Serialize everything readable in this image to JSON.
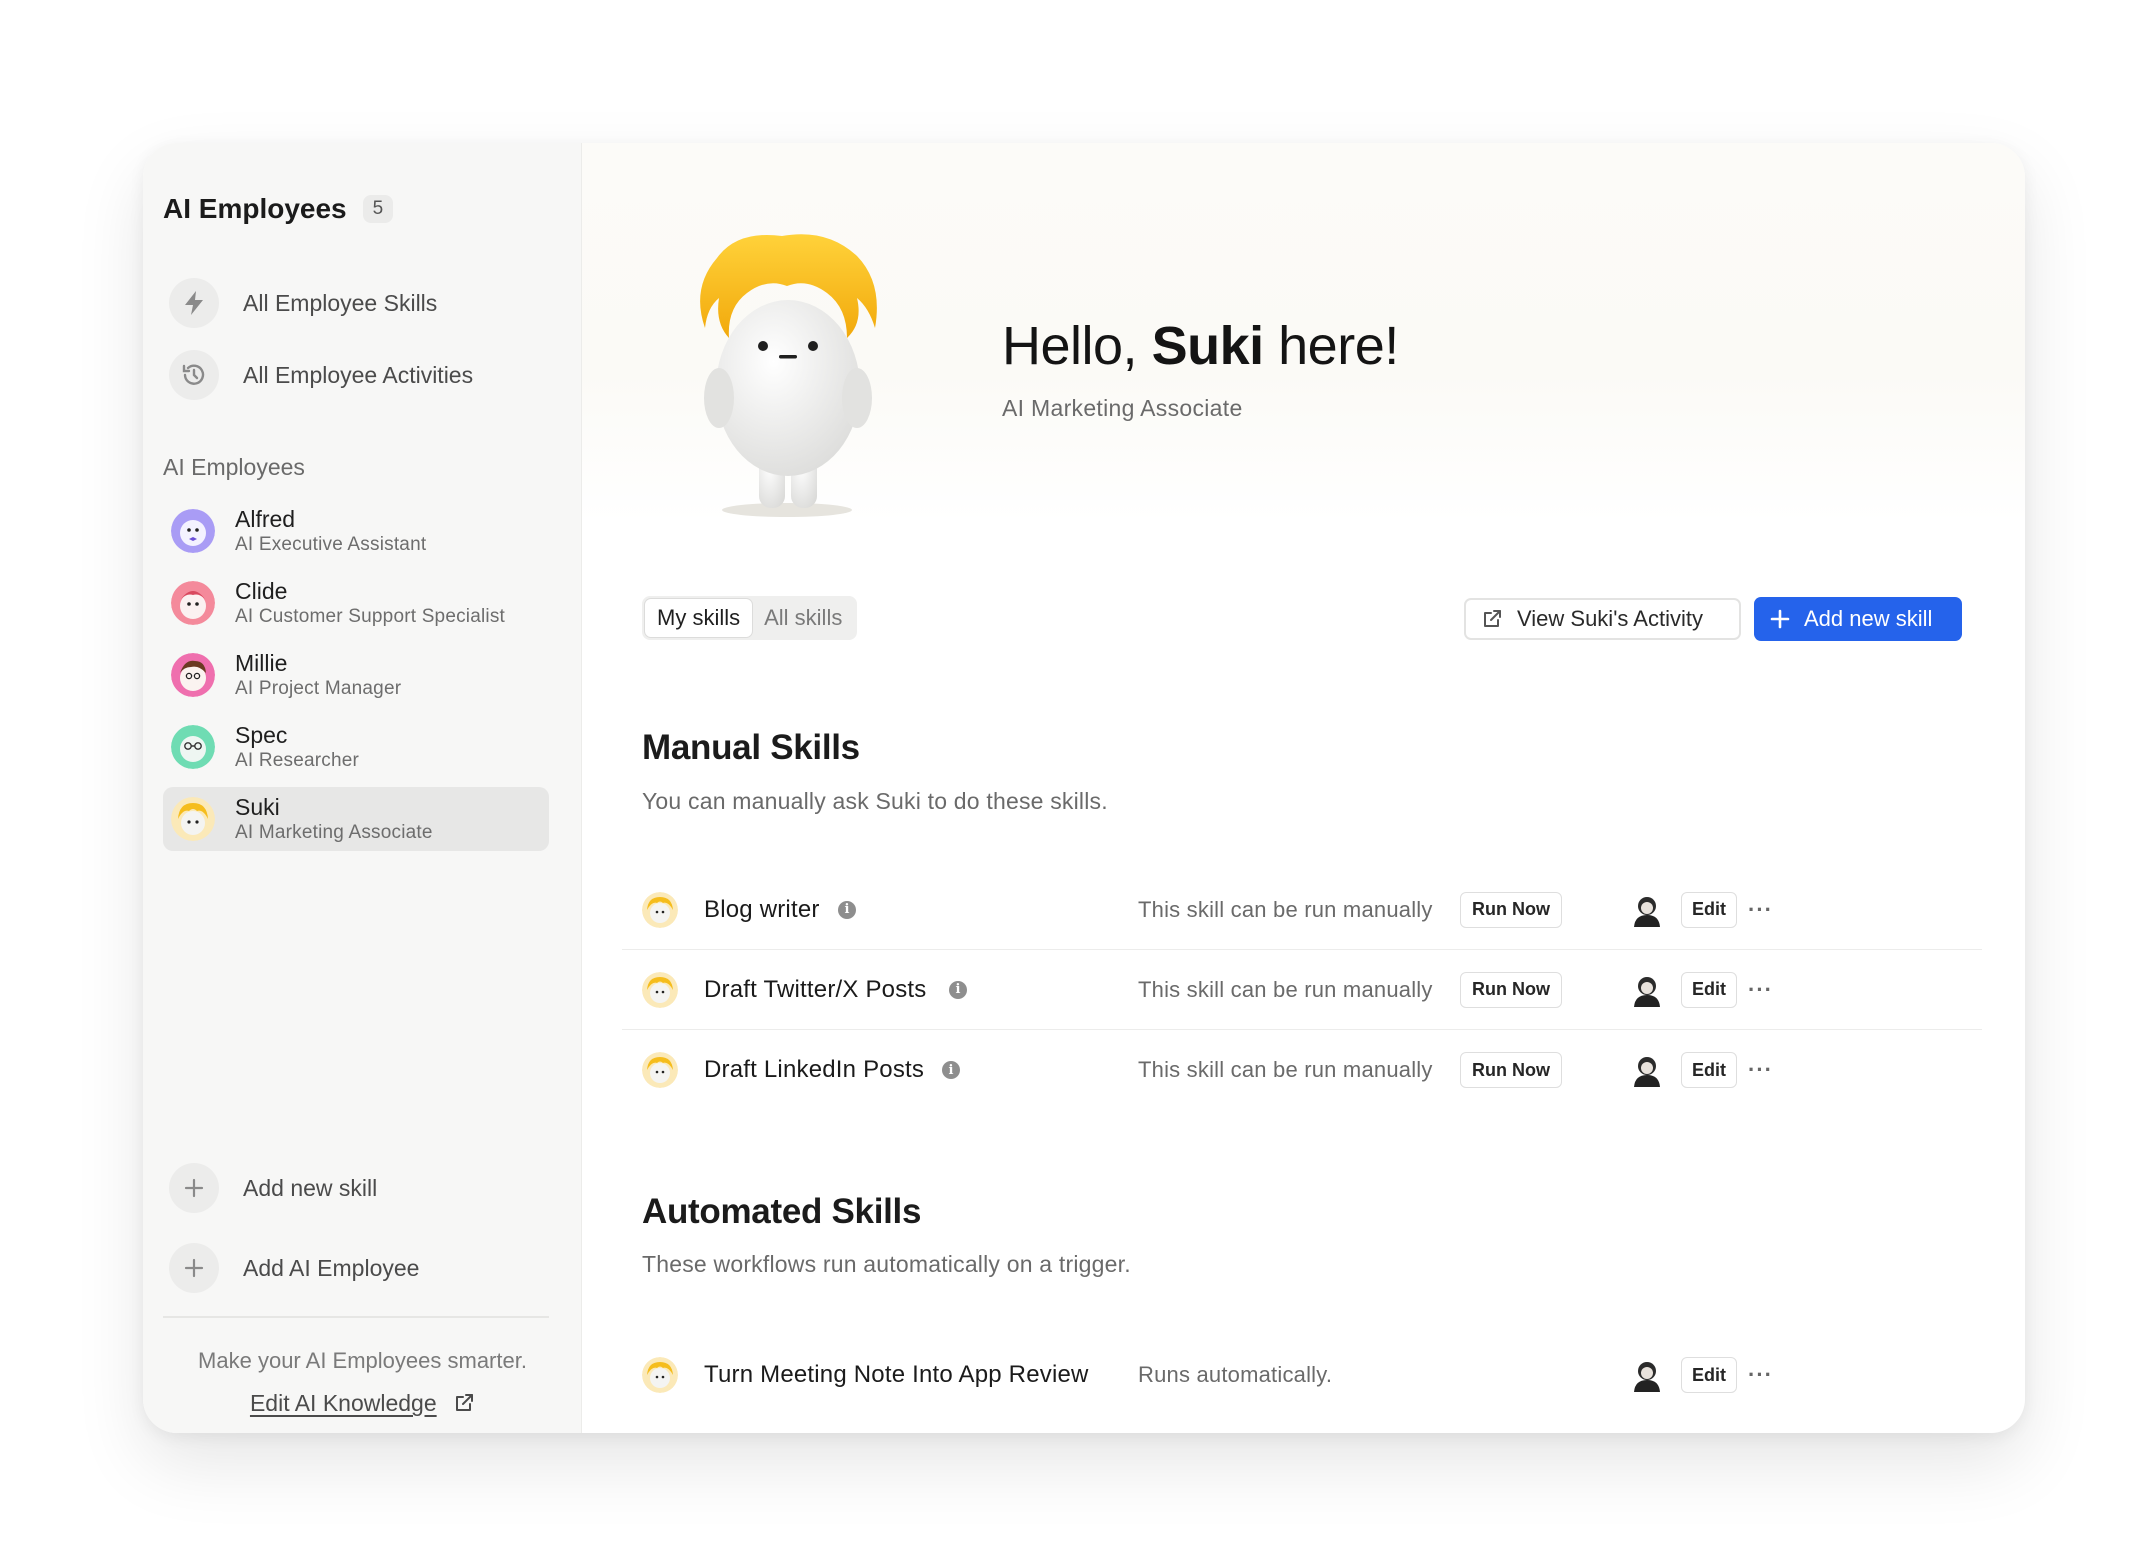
{
  "sidebar": {
    "title": "AI Employees",
    "count": "5",
    "nav": [
      {
        "label": "All Employee Skills",
        "icon": "bolt-icon"
      },
      {
        "label": "All Employee Activities",
        "icon": "history-icon"
      }
    ],
    "section_title": "AI Employees",
    "employees": [
      {
        "name": "Alfred",
        "role": "AI Executive Assistant",
        "color": "#8b7cf0"
      },
      {
        "name": "Clide",
        "role": "AI Customer Support Specialist",
        "color": "#f07a8c"
      },
      {
        "name": "Millie",
        "role": "AI Project Manager",
        "color": "#e8609c"
      },
      {
        "name": "Spec",
        "role": "AI Researcher",
        "color": "#5fd1a8"
      },
      {
        "name": "Suki",
        "role": "AI Marketing Associate",
        "color": "#f5c232",
        "active": true
      }
    ],
    "bottom_actions": [
      {
        "label": "Add new skill",
        "icon": "plus-icon"
      },
      {
        "label": "Add AI Employee",
        "icon": "plus-icon"
      }
    ],
    "footer_text": "Make your AI Employees smarter.",
    "footer_link": "Edit AI Knowledge"
  },
  "hero": {
    "greeting": "Hello,",
    "name": "Suki",
    "suffix": "here!",
    "role": "AI Marketing Associate"
  },
  "tabs": [
    {
      "label": "My skills",
      "active": true
    },
    {
      "label": "All skills",
      "active": false
    }
  ],
  "actions": {
    "activity_label": "View Suki's Activity",
    "add_label": "Add new skill",
    "accent": "#2563eb"
  },
  "manual": {
    "title": "Manual Skills",
    "description": "You can manually ask Suki to do these skills.",
    "skills": [
      {
        "name": "Blog writer",
        "status": "This skill can be run manually",
        "run": "Run Now",
        "edit": "Edit",
        "more": "···"
      },
      {
        "name": "Draft Twitter/X Posts",
        "status": "This skill can be run manually",
        "run": "Run Now",
        "edit": "Edit",
        "more": "···"
      },
      {
        "name": "Draft LinkedIn Posts",
        "status": "This skill can be run manually",
        "run": "Run Now",
        "edit": "Edit",
        "more": "···"
      }
    ]
  },
  "automated": {
    "title": "Automated Skills",
    "description": "These workflows run automatically on a trigger.",
    "skills": [
      {
        "name": "Turn Meeting Note Into App Review",
        "status": "Runs automatically.",
        "edit": "Edit",
        "more": "···"
      }
    ]
  }
}
